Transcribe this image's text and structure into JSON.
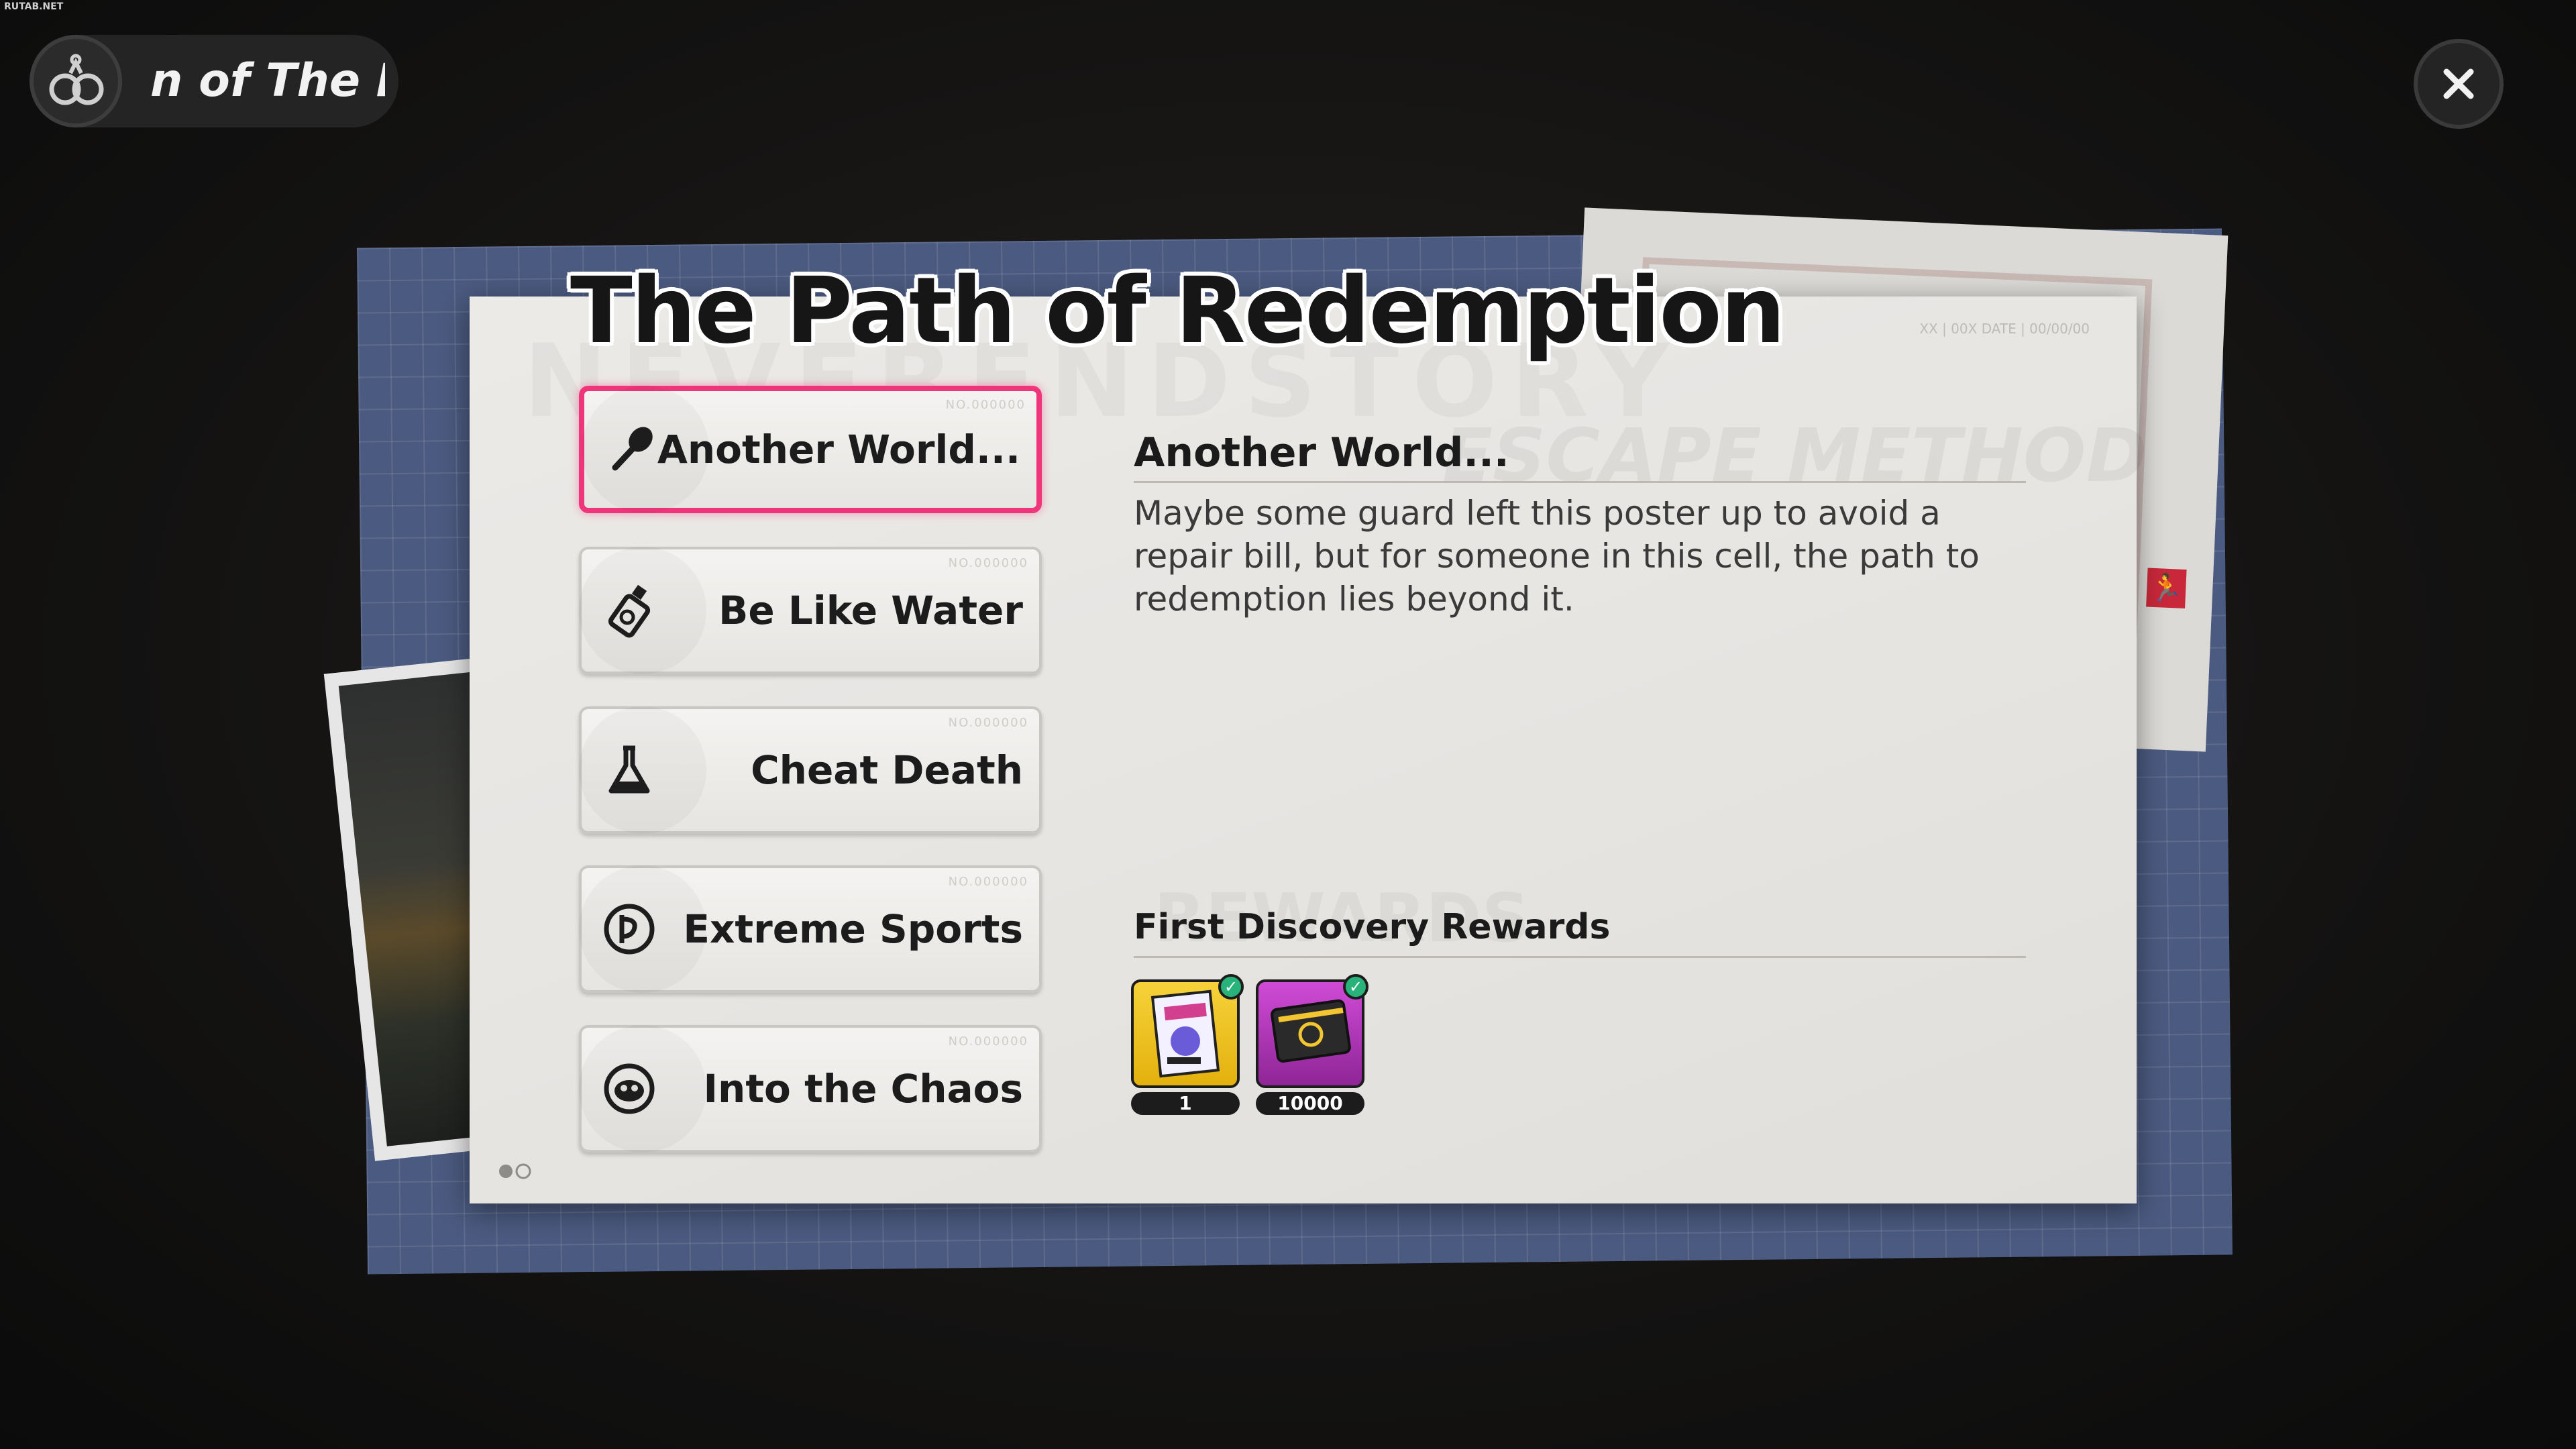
{
  "watermark": "RUTAB.NET",
  "header": {
    "ticker_text": "n of   The P",
    "badge_icon": "handcuffs-icon",
    "close_icon": "close-icon"
  },
  "card": {
    "title": "The Path of Redemption",
    "background_word": "NEVERENDSTORY",
    "doc_number": "XX | 00X   DATE | 00/00/00"
  },
  "options": [
    {
      "label": "Another World...",
      "icon": "spoon-icon",
      "number": "NO.000000",
      "selected": true
    },
    {
      "label": "Be Like Water",
      "icon": "shampoo-bottle-icon",
      "number": "NO.000000",
      "selected": false
    },
    {
      "label": "Cheat Death",
      "icon": "flask-icon",
      "number": "NO.000000",
      "selected": false
    },
    {
      "label": "Extreme Sports",
      "icon": "sports-emblem-icon",
      "number": "NO.000000",
      "selected": false
    },
    {
      "label": "Into the Chaos",
      "icon": "monkey-face-icon",
      "number": "NO.000000",
      "selected": false
    }
  ],
  "detail": {
    "title": "Another World...",
    "background_word": "ESCAPE METHOD",
    "description": "Maybe some guard left this poster up to avoid a repair bill, but for someone in this cell, the path to redemption lies beyond it."
  },
  "rewards": {
    "title": "First Discovery Rewards",
    "background_word": "REWARDS",
    "items": [
      {
        "name": "poster-item",
        "quantity": "1",
        "claimed": true,
        "color": "#e3b10d"
      },
      {
        "name": "dennies-card-item",
        "quantity": "10000",
        "claimed": true,
        "color": "#b43ac0"
      }
    ]
  },
  "colors": {
    "selected_border": "#f0367a",
    "blueprint": "#4b5a80",
    "claimed_check": "#28b37a"
  }
}
